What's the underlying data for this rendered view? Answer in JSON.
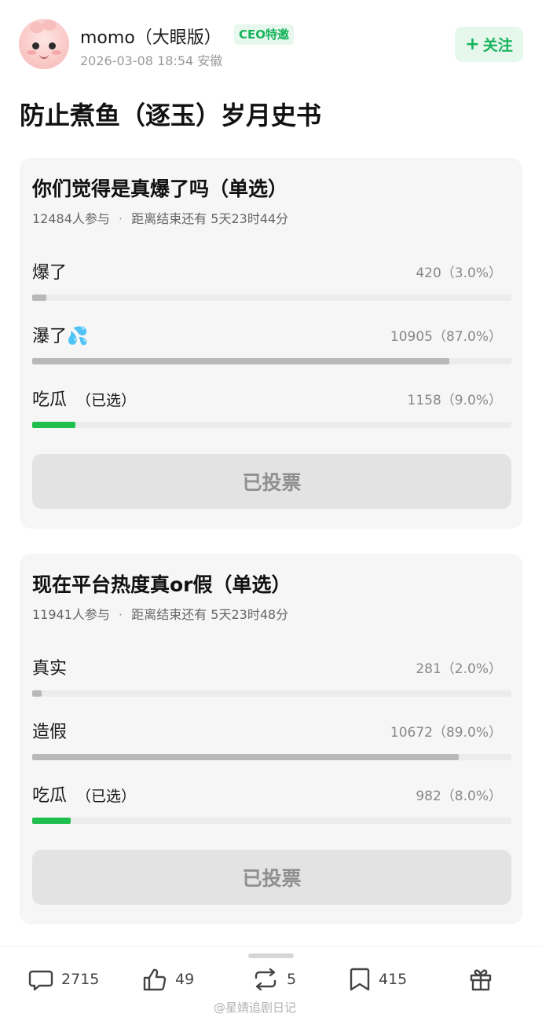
{
  "header": {
    "username": "momo（大眼版）",
    "badge": "CEO特邀",
    "meta": "2026-03-08 18:54  安徽",
    "follow_label": "关注",
    "follow_plus": "+"
  },
  "post": {
    "title": "防止煮鱼（逐玉）岁月史书"
  },
  "polls": [
    {
      "question": "你们觉得是真爆了吗（单选）",
      "participants": "12484人参与",
      "separator": "·",
      "deadline": "距离结束还有 5天23时44分",
      "options": [
        {
          "label": "爆了",
          "count": "420（3.0%）",
          "percent": 3.0,
          "selected": false
        },
        {
          "label": "瀑了💦",
          "count": "10905（87.0%）",
          "percent": 87.0,
          "selected": false
        },
        {
          "label": "吃瓜",
          "selected_label": "（已选）",
          "count": "1158（9.0%）",
          "percent": 9.0,
          "selected": true
        }
      ],
      "vote_label": "已投票"
    },
    {
      "question": "现在平台热度真or假（单选）",
      "participants": "11941人参与",
      "separator": "·",
      "deadline": "距离结束还有 5天23时48分",
      "options": [
        {
          "label": "真实",
          "count": "281（2.0%）",
          "percent": 2.0,
          "selected": false
        },
        {
          "label": "造假",
          "count": "10672（89.0%）",
          "percent": 89.0,
          "selected": false
        },
        {
          "label": "吃瓜",
          "selected_label": "（已选）",
          "count": "982（8.0%）",
          "percent": 8.0,
          "selected": true
        }
      ],
      "vote_label": "已投票"
    }
  ],
  "actions": {
    "comments": "2715",
    "likes": "49",
    "reposts": "5",
    "favorites": "415"
  },
  "watermark": "@星婧追剧日记",
  "colors": {
    "accent_green": "#17b35c",
    "selected_bar": "#1fbf4f",
    "bar_gray": "#b8b8b8",
    "card_bg": "#f6f6f6"
  }
}
